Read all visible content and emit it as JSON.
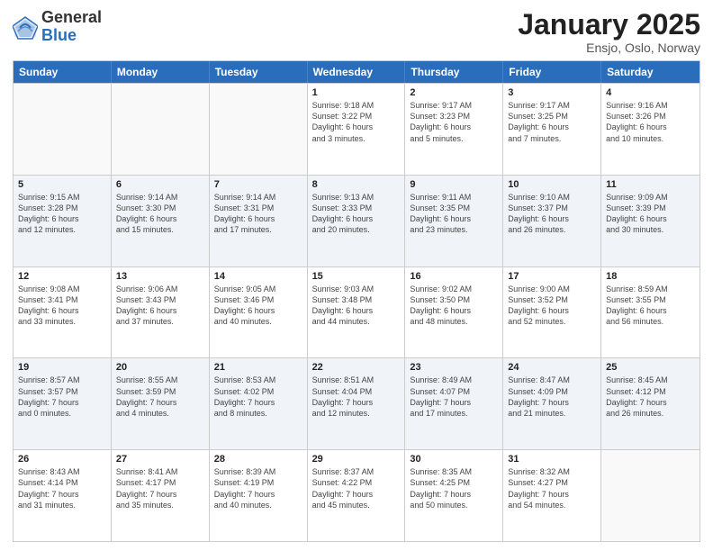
{
  "logo": {
    "general": "General",
    "blue": "Blue"
  },
  "header": {
    "title": "January 2025",
    "location": "Ensjo, Oslo, Norway"
  },
  "days_of_week": [
    "Sunday",
    "Monday",
    "Tuesday",
    "Wednesday",
    "Thursday",
    "Friday",
    "Saturday"
  ],
  "weeks": [
    [
      {
        "day": "",
        "info": ""
      },
      {
        "day": "",
        "info": ""
      },
      {
        "day": "",
        "info": ""
      },
      {
        "day": "1",
        "info": "Sunrise: 9:18 AM\nSunset: 3:22 PM\nDaylight: 6 hours\nand 3 minutes."
      },
      {
        "day": "2",
        "info": "Sunrise: 9:17 AM\nSunset: 3:23 PM\nDaylight: 6 hours\nand 5 minutes."
      },
      {
        "day": "3",
        "info": "Sunrise: 9:17 AM\nSunset: 3:25 PM\nDaylight: 6 hours\nand 7 minutes."
      },
      {
        "day": "4",
        "info": "Sunrise: 9:16 AM\nSunset: 3:26 PM\nDaylight: 6 hours\nand 10 minutes."
      }
    ],
    [
      {
        "day": "5",
        "info": "Sunrise: 9:15 AM\nSunset: 3:28 PM\nDaylight: 6 hours\nand 12 minutes."
      },
      {
        "day": "6",
        "info": "Sunrise: 9:14 AM\nSunset: 3:30 PM\nDaylight: 6 hours\nand 15 minutes."
      },
      {
        "day": "7",
        "info": "Sunrise: 9:14 AM\nSunset: 3:31 PM\nDaylight: 6 hours\nand 17 minutes."
      },
      {
        "day": "8",
        "info": "Sunrise: 9:13 AM\nSunset: 3:33 PM\nDaylight: 6 hours\nand 20 minutes."
      },
      {
        "day": "9",
        "info": "Sunrise: 9:11 AM\nSunset: 3:35 PM\nDaylight: 6 hours\nand 23 minutes."
      },
      {
        "day": "10",
        "info": "Sunrise: 9:10 AM\nSunset: 3:37 PM\nDaylight: 6 hours\nand 26 minutes."
      },
      {
        "day": "11",
        "info": "Sunrise: 9:09 AM\nSunset: 3:39 PM\nDaylight: 6 hours\nand 30 minutes."
      }
    ],
    [
      {
        "day": "12",
        "info": "Sunrise: 9:08 AM\nSunset: 3:41 PM\nDaylight: 6 hours\nand 33 minutes."
      },
      {
        "day": "13",
        "info": "Sunrise: 9:06 AM\nSunset: 3:43 PM\nDaylight: 6 hours\nand 37 minutes."
      },
      {
        "day": "14",
        "info": "Sunrise: 9:05 AM\nSunset: 3:46 PM\nDaylight: 6 hours\nand 40 minutes."
      },
      {
        "day": "15",
        "info": "Sunrise: 9:03 AM\nSunset: 3:48 PM\nDaylight: 6 hours\nand 44 minutes."
      },
      {
        "day": "16",
        "info": "Sunrise: 9:02 AM\nSunset: 3:50 PM\nDaylight: 6 hours\nand 48 minutes."
      },
      {
        "day": "17",
        "info": "Sunrise: 9:00 AM\nSunset: 3:52 PM\nDaylight: 6 hours\nand 52 minutes."
      },
      {
        "day": "18",
        "info": "Sunrise: 8:59 AM\nSunset: 3:55 PM\nDaylight: 6 hours\nand 56 minutes."
      }
    ],
    [
      {
        "day": "19",
        "info": "Sunrise: 8:57 AM\nSunset: 3:57 PM\nDaylight: 7 hours\nand 0 minutes."
      },
      {
        "day": "20",
        "info": "Sunrise: 8:55 AM\nSunset: 3:59 PM\nDaylight: 7 hours\nand 4 minutes."
      },
      {
        "day": "21",
        "info": "Sunrise: 8:53 AM\nSunset: 4:02 PM\nDaylight: 7 hours\nand 8 minutes."
      },
      {
        "day": "22",
        "info": "Sunrise: 8:51 AM\nSunset: 4:04 PM\nDaylight: 7 hours\nand 12 minutes."
      },
      {
        "day": "23",
        "info": "Sunrise: 8:49 AM\nSunset: 4:07 PM\nDaylight: 7 hours\nand 17 minutes."
      },
      {
        "day": "24",
        "info": "Sunrise: 8:47 AM\nSunset: 4:09 PM\nDaylight: 7 hours\nand 21 minutes."
      },
      {
        "day": "25",
        "info": "Sunrise: 8:45 AM\nSunset: 4:12 PM\nDaylight: 7 hours\nand 26 minutes."
      }
    ],
    [
      {
        "day": "26",
        "info": "Sunrise: 8:43 AM\nSunset: 4:14 PM\nDaylight: 7 hours\nand 31 minutes."
      },
      {
        "day": "27",
        "info": "Sunrise: 8:41 AM\nSunset: 4:17 PM\nDaylight: 7 hours\nand 35 minutes."
      },
      {
        "day": "28",
        "info": "Sunrise: 8:39 AM\nSunset: 4:19 PM\nDaylight: 7 hours\nand 40 minutes."
      },
      {
        "day": "29",
        "info": "Sunrise: 8:37 AM\nSunset: 4:22 PM\nDaylight: 7 hours\nand 45 minutes."
      },
      {
        "day": "30",
        "info": "Sunrise: 8:35 AM\nSunset: 4:25 PM\nDaylight: 7 hours\nand 50 minutes."
      },
      {
        "day": "31",
        "info": "Sunrise: 8:32 AM\nSunset: 4:27 PM\nDaylight: 7 hours\nand 54 minutes."
      },
      {
        "day": "",
        "info": ""
      }
    ]
  ]
}
